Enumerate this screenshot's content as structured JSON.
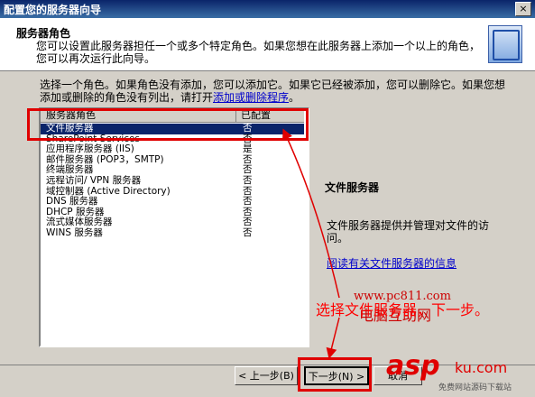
{
  "window": {
    "title": "配置您的服务器向导",
    "close_label": "×"
  },
  "header": {
    "title": "服务器角色",
    "description": "您可以设置此服务器担任一个或多个特定角色。如果您想在此服务器上添加一个以上的角色，您可以再次运行此向导。"
  },
  "intro": {
    "text": "选择一个角色。如果角色没有添加，您可以添加它。如果它已经被添加，您可以删除它。如果您想添加或删除的角色没有列出，请打开",
    "link": "添加或删除程序",
    "suffix": "。"
  },
  "list": {
    "col_role": "服务器角色",
    "col_status": "已配置",
    "rows": [
      {
        "name": "文件服务器",
        "status": "否"
      },
      {
        "name": "SharePoint Services",
        "status": "否"
      },
      {
        "name": "应用程序服务器 (IIS)",
        "status": "是"
      },
      {
        "name": "邮件服务器 (POP3，SMTP)",
        "status": "否"
      },
      {
        "name": "终端服务器",
        "status": "否"
      },
      {
        "name": "远程访问/ VPN 服务器",
        "status": "否"
      },
      {
        "name": "域控制器 (Active Directory)",
        "status": "否"
      },
      {
        "name": "DNS 服务器",
        "status": "否"
      },
      {
        "name": "DHCP 服务器",
        "status": "否"
      },
      {
        "name": "流式媒体服务器",
        "status": "否"
      },
      {
        "name": "WINS 服务器",
        "status": "否"
      }
    ]
  },
  "detail": {
    "title": "文件服务器",
    "description": "文件服务器提供并管理对文件的访问。",
    "link": "阅读有关文件服务器的信息"
  },
  "watermark": {
    "url": "www.pc811.com",
    "name": "电脑互助网"
  },
  "annotation": "选择文件服务器，下一步。",
  "buttons": {
    "back": "< 上一步(B)",
    "next": "下一步(N) >",
    "cancel": "取消"
  },
  "logo": {
    "main": "asp",
    "ku": "ku",
    "tail": ".com",
    "sub": "免费网站源码下载站"
  },
  "colors": {
    "selection": "#0a246a",
    "annotation_red": "#e00000",
    "link": "#0000cc"
  }
}
